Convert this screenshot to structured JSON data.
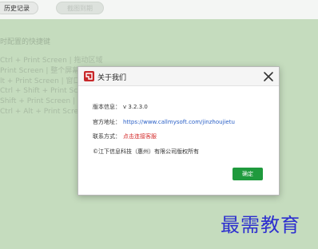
{
  "toolbar": {
    "history_label": "历史记录",
    "other_label": "截图到期"
  },
  "background": {
    "heading": "时配置的快捷键",
    "lines": [
      "Ctrl + Print Screen  |  拖动区域",
      "Print Screen  |  整个屏幕",
      "lt + Print Screen  |  窗口",
      "Ctrl + Shift + Print Screen  |",
      "Shift + Print Screen  |  文",
      "Ctrl + Alt + Print Screen  |"
    ]
  },
  "dialog": {
    "title": "关于我们",
    "version_label": "版本信息：",
    "version_value": "v 3.2.3.0",
    "site_label": "官方地址：",
    "site_value": "https://www.callmysoft.com/jinzhoujietu",
    "contact_label": "联系方式：",
    "contact_value": "点击连接客服",
    "copyright": "©江下信息科技（惠州）有限公司版权所有",
    "ok_label": "确定"
  },
  "watermark": "最需教育",
  "colors": {
    "background": "#c5dcbe",
    "link": "#2a60c7",
    "contact": "#d42d2d",
    "ok_button": "#1f9a3d",
    "app_icon": "#c8282a",
    "watermark": "#2d2fcf"
  },
  "icons": {
    "app": "app-logo-icon",
    "close": "close-icon"
  }
}
